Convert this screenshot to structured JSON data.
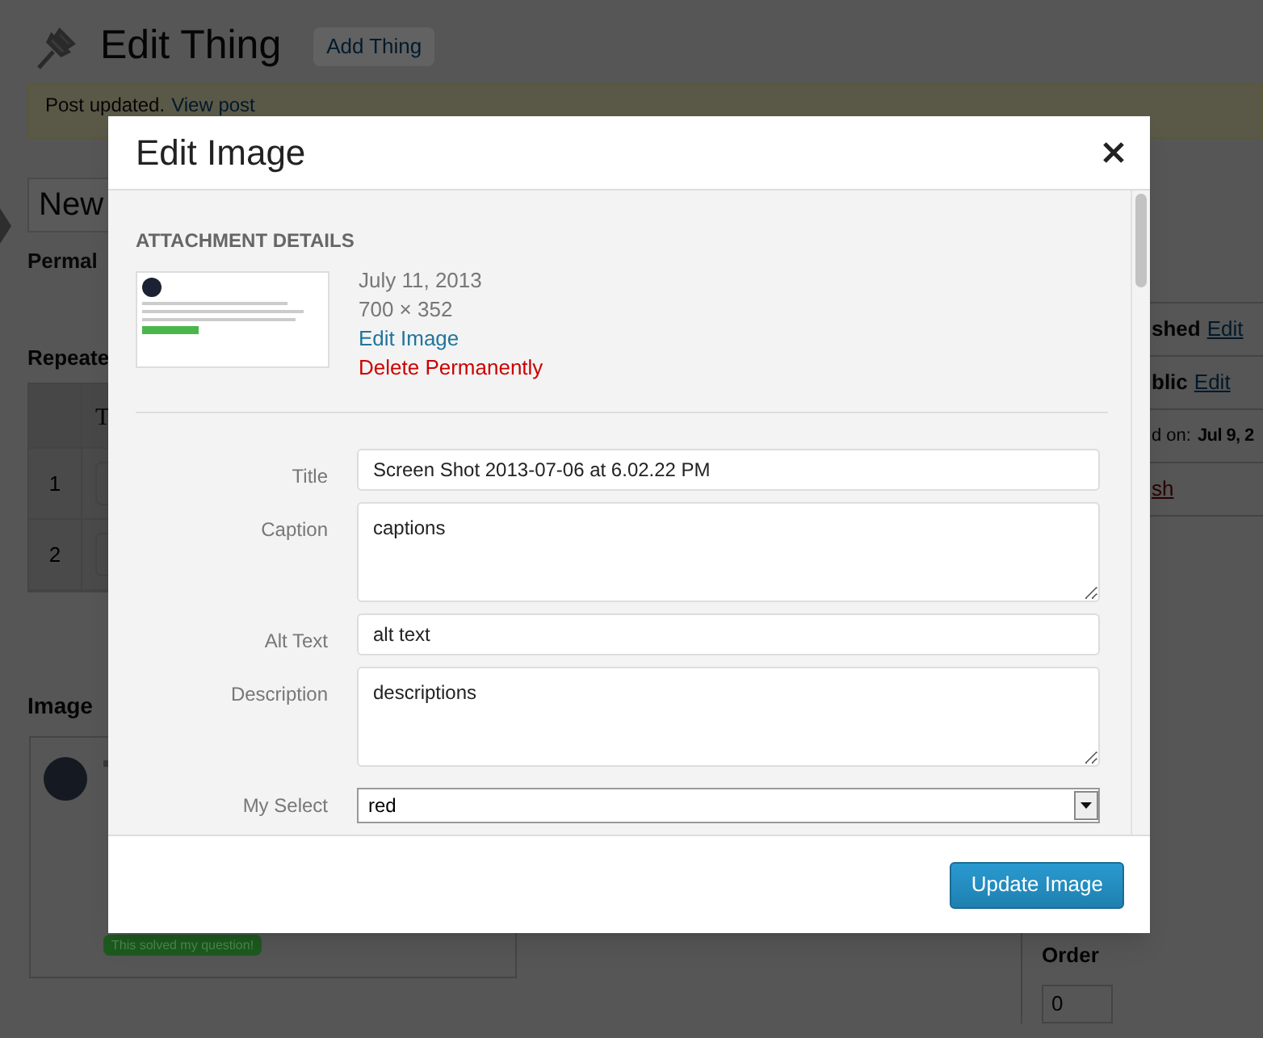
{
  "page": {
    "title": "Edit Thing",
    "add_button": "Add Thing",
    "notice": {
      "text": "Post updated.",
      "link": "View post"
    },
    "post_title": "New",
    "permalink_label": "Permal",
    "repeater": {
      "heading": "Repeate",
      "column_1": "T",
      "rows": [
        "1",
        "2"
      ]
    },
    "image_section": {
      "heading": "Image",
      "button": "This solved my question!"
    },
    "sidebar": {
      "rows": [
        {
          "kind": "link",
          "text": "shed",
          "link": "Edit"
        },
        {
          "kind": "link",
          "text": "blic",
          "link": "Edit"
        },
        {
          "kind": "date",
          "text": "d on:",
          "value": "Jul 9, 2"
        },
        {
          "kind": "danger",
          "text": "sh"
        }
      ],
      "order_label": "Order",
      "order_value": "0"
    }
  },
  "modal": {
    "title": "Edit Image",
    "section": "ATTACHMENT DETAILS",
    "date": "July 11, 2013",
    "dimensions": "700 × 352",
    "edit_link": "Edit Image",
    "delete_link": "Delete Permanently",
    "fields": [
      {
        "kind": "text",
        "label": "Title",
        "value": "Screen Shot 2013-07-06 at 6.02.22 PM"
      },
      {
        "kind": "textarea",
        "label": "Caption",
        "value": "captions"
      },
      {
        "kind": "text",
        "label": "Alt Text",
        "value": "alt text"
      },
      {
        "kind": "textarea",
        "label": "Description",
        "value": "descriptions"
      },
      {
        "kind": "select",
        "label": "My Select",
        "value": "red"
      }
    ],
    "submit": "Update Image"
  }
}
